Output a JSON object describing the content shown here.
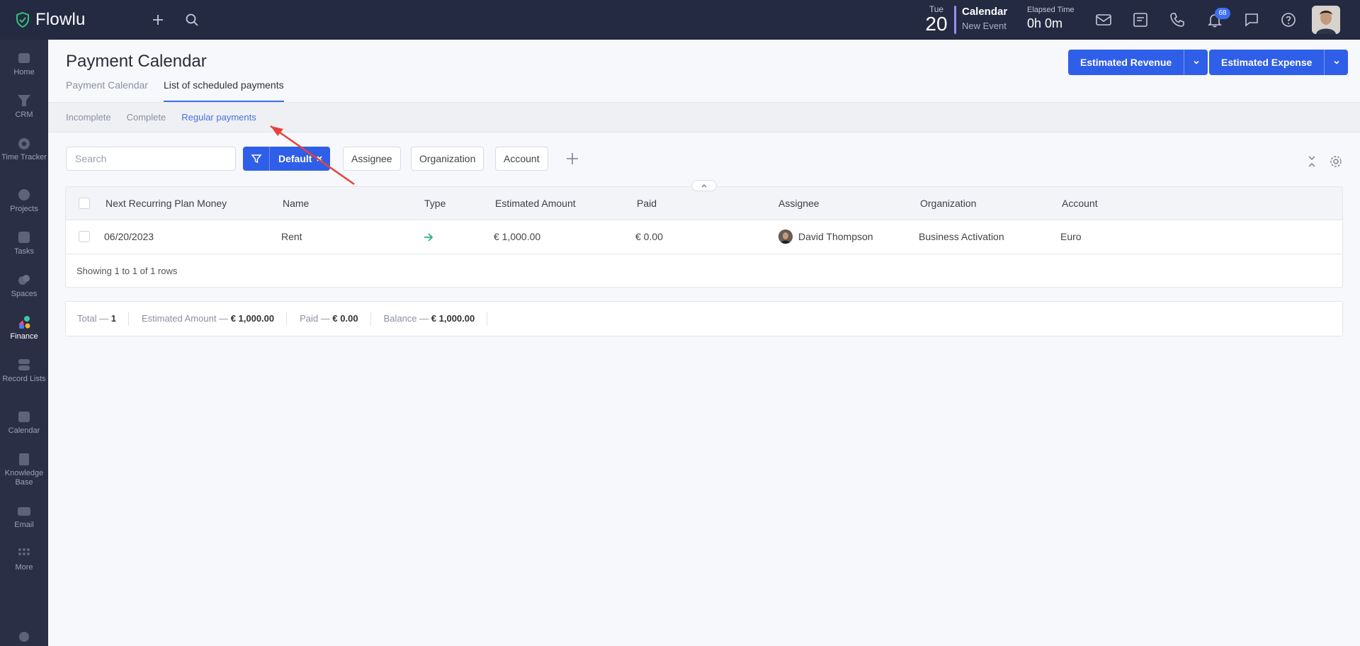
{
  "app": {
    "name": "Flowlu"
  },
  "topbar": {
    "date_dow": "Tue",
    "date_day": "20",
    "calendar_title": "Calendar",
    "calendar_sub": "New Event",
    "elapsed_label": "Elapsed Time",
    "elapsed_value": "0h 0m",
    "notification_count": "68"
  },
  "sidebar": {
    "items": [
      {
        "label": "Home",
        "icon": "home-icon"
      },
      {
        "label": "CRM",
        "icon": "crm-icon"
      },
      {
        "label": "Time Tracker",
        "icon": "time-tracker-icon"
      },
      {
        "label": "Projects",
        "icon": "projects-icon"
      },
      {
        "label": "Tasks",
        "icon": "tasks-icon"
      },
      {
        "label": "Spaces",
        "icon": "spaces-icon"
      },
      {
        "label": "Finance",
        "icon": "finance-icon"
      },
      {
        "label": "Record Lists",
        "icon": "record-lists-icon"
      },
      {
        "label": "Calendar",
        "icon": "calendar-icon"
      },
      {
        "label": "Knowledge Base",
        "icon": "knowledge-base-icon"
      },
      {
        "label": "Email",
        "icon": "email-icon"
      },
      {
        "label": "More",
        "icon": "more-icon"
      }
    ]
  },
  "header": {
    "title": "Payment Calendar",
    "tabs": [
      "Payment Calendar",
      "List of scheduled payments"
    ],
    "btn_revenue": "Estimated Revenue",
    "btn_expense": "Estimated Expense"
  },
  "subtabs": [
    "Incomplete",
    "Complete",
    "Regular payments"
  ],
  "filters": {
    "search_placeholder": "Search",
    "preset": "Default",
    "chips": [
      "Assignee",
      "Organization",
      "Account"
    ]
  },
  "table": {
    "columns": [
      "Next Recurring Plan Money",
      "Name",
      "Type",
      "Estimated Amount",
      "Paid",
      "Assignee",
      "Organization",
      "Account"
    ],
    "rows": [
      {
        "date": "06/20/2023",
        "name": "Rent",
        "type": "incoming-arrow-icon",
        "estimated": "€ 1,000.00",
        "paid": "€ 0.00",
        "assignee": "David Thompson",
        "organization": "Business Activation",
        "account": "Euro"
      }
    ],
    "rows_info": "Showing 1 to 1 of 1 rows"
  },
  "totals": {
    "total_label": "Total —",
    "total_value": "1",
    "est_label": "Estimated Amount —",
    "est_value": "€ 1,000.00",
    "paid_label": "Paid —",
    "paid_value": "€ 0.00",
    "balance_label": "Balance —",
    "balance_value": "€ 1,000.00"
  },
  "colors": {
    "accent": "#2f5fe8",
    "topbar": "#242a41",
    "sidebar": "#2a2f45",
    "annotation": "#e8413c",
    "income": "#27b384"
  }
}
